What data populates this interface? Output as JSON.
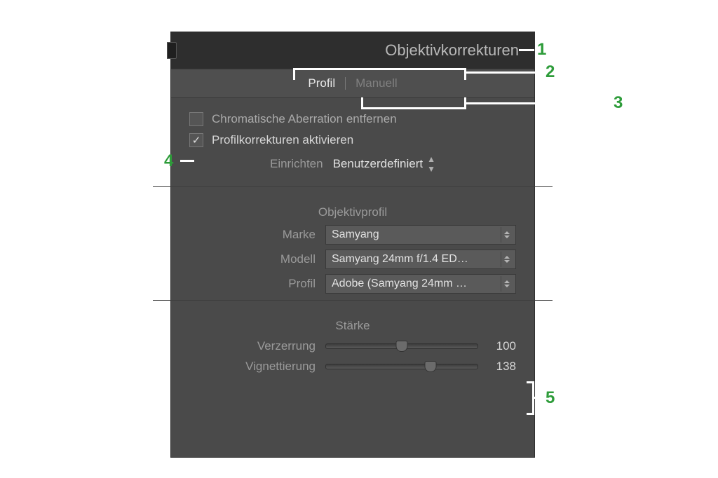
{
  "panel": {
    "title": "Objektivkorrekturen",
    "tabs": {
      "profil": "Profil",
      "manuell": "Manuell"
    },
    "checks": {
      "chroma": "Chromatische Aberration entfernen",
      "profile": "Profilkorrekturen aktivieren"
    },
    "setup": {
      "label": "Einrichten",
      "value": "Benutzerdefiniert"
    },
    "lensprofile": {
      "title": "Objektivprofil",
      "marke_label": "Marke",
      "marke_value": "Samyang",
      "modell_label": "Modell",
      "modell_value": "Samyang 24mm f/1.4 ED…",
      "profil_label": "Profil",
      "profil_value": "Adobe (Samyang 24mm …"
    },
    "strength": {
      "title": "Stärke",
      "distortion_label": "Verzerrung",
      "distortion_value": "100",
      "vignette_label": "Vignettierung",
      "vignette_value": "138"
    }
  },
  "callouts": {
    "1": "1",
    "2": "2",
    "3": "3",
    "4": "4",
    "5": "5"
  }
}
